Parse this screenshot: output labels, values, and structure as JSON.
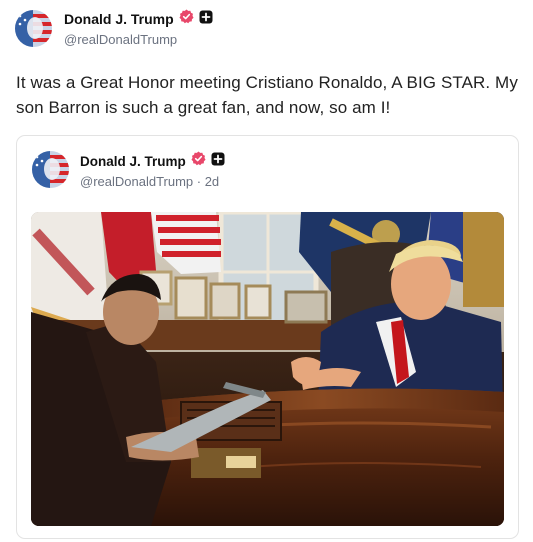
{
  "post": {
    "author_name": "Donald J. Trump",
    "author_handle": "@realDonaldTrump",
    "text": "It was a Great Honor meeting Cristiano Ronaldo, A BIG STAR. My son Barron is such a great fan, and now, so am I!",
    "icons": {
      "avatar": "flag-portrait-avatar",
      "verified": "verified-badge-icon",
      "plus": "plus-badge-icon"
    }
  },
  "quoted_post": {
    "author_name": "Donald J. Trump",
    "author_handle": "@realDonaldTrump · 2d",
    "photo": "oval-office-meeting-photo"
  },
  "colors": {
    "verified_badge": "#e8476a",
    "plus_badge": "#111111",
    "handle_text": "#6b7280",
    "card_border": "#e3e3e3"
  }
}
